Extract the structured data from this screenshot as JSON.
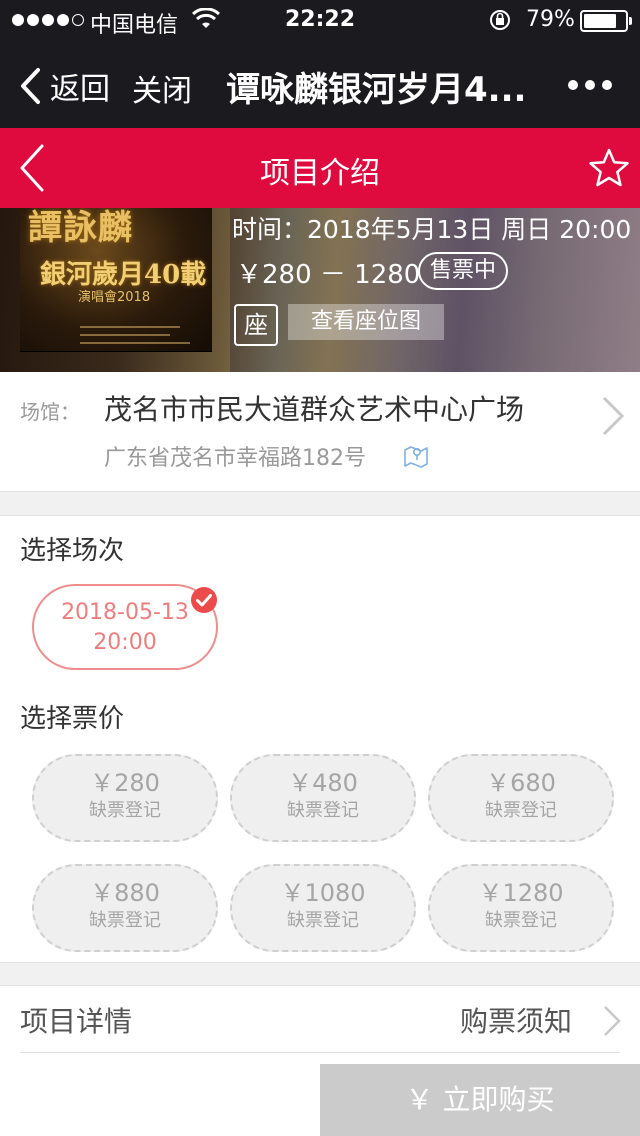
{
  "status_bar": {
    "carrier": "中国电信",
    "time": "22:22",
    "battery_percent": "79%",
    "battery_level": 0.79
  },
  "nav_bar": {
    "back_label": "返回",
    "close_label": "关闭",
    "title": "谭咏麟银河岁月4..."
  },
  "header": {
    "title": "项目介绍"
  },
  "event": {
    "poster_title": "譚詠麟",
    "poster_subtitle": "銀河歲月40載",
    "poster_caption": "演唱會2018",
    "time": "时间：2018年5月13日 周日 20:00",
    "price_range": "￥280 － 1280",
    "status_badge": "售票中",
    "seat_label": "座",
    "seat_map_label": "查看座位图"
  },
  "venue": {
    "label": "场馆：",
    "name": "茂名市市民大道群众艺术中心广场",
    "address": "广东省茂名市幸福路182号"
  },
  "session": {
    "section_title": "选择场次",
    "date": "2018-05-13",
    "time": "20:00"
  },
  "tickets": {
    "section_title": "选择票价",
    "items": [
      {
        "price": "￥280",
        "status": "缺票登记"
      },
      {
        "price": "￥480",
        "status": "缺票登记"
      },
      {
        "price": "￥680",
        "status": "缺票登记"
      },
      {
        "price": "￥880",
        "status": "缺票登记"
      },
      {
        "price": "￥1080",
        "status": "缺票登记"
      },
      {
        "price": "￥1280",
        "status": "缺票登记"
      }
    ]
  },
  "details": {
    "project_details": "项目详情",
    "purchase_notice": "购票须知"
  },
  "buy_button": {
    "label": "￥ 立即购买"
  },
  "colors": {
    "accent": "#df0b3f",
    "dark_bar": "#1b1b1f",
    "session_border": "#f08c8c",
    "disabled": "#cbcbcb"
  }
}
